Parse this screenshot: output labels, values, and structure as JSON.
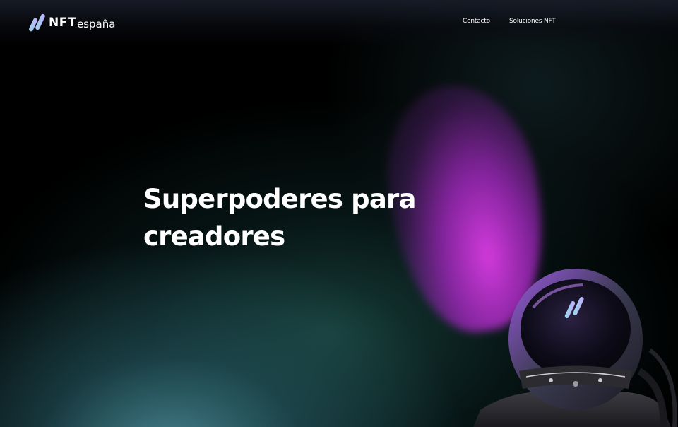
{
  "brand": {
    "name_primary": "NFT",
    "name_secondary": "españa",
    "logo_icon": "slash-logo-icon"
  },
  "nav": {
    "items": [
      {
        "label": "Contacto"
      },
      {
        "label": "Soluciones NFT"
      }
    ]
  },
  "hero": {
    "title_line1": "Superpoderes para",
    "title_line2": "creadores",
    "image_icon": "astronaut-helmet-image"
  },
  "colors": {
    "background": "#000000",
    "accent_purple": "#c23fd6",
    "accent_teal": "#4b8f99",
    "logo_gradient_start": "#c9a5ff",
    "logo_gradient_end": "#8fe0e8",
    "text": "#ffffff"
  }
}
